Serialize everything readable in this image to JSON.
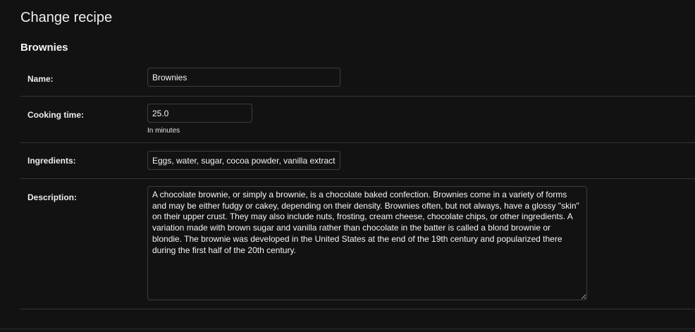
{
  "page": {
    "title": "Change recipe"
  },
  "fieldset": {
    "title": "Brownies"
  },
  "fields": {
    "name": {
      "label": "Name:",
      "value": "Brownies"
    },
    "cooking_time": {
      "label": "Cooking time:",
      "value": "25.0",
      "help": "In minutes"
    },
    "ingredients": {
      "label": "Ingredients:",
      "value": "Eggs, water, sugar, cocoa powder, vanilla extract"
    },
    "description": {
      "label": "Description:",
      "value": "A chocolate brownie, or simply a brownie, is a chocolate baked confection. Brownies come in a variety of forms and may be either fudgy or cakey, depending on their density. Brownies often, but not always, have a glossy \"skin\" on their upper crust. They may also include nuts, frosting, cream cheese, chocolate chips, or other ingredients. A variation made with brown sugar and vanilla rather than chocolate in the batter is called a blond brownie or blondie. The brownie was developed in the United States at the end of the 19th century and popularized there during the first half of the 20th century."
    }
  },
  "colors": {
    "background": "#121212",
    "border": "#3d3d3d",
    "divider": "#353535",
    "text": "#f5f5f5"
  }
}
